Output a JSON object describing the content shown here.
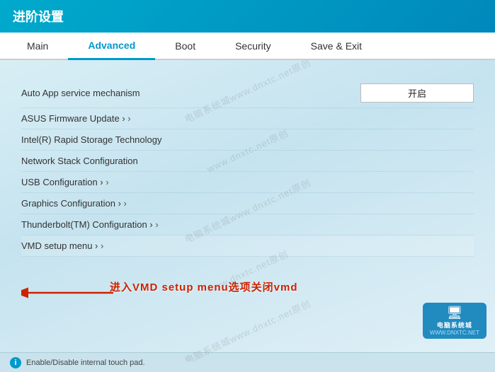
{
  "titleBar": {
    "text": "进阶设置"
  },
  "tabs": [
    {
      "id": "main",
      "label": "Main",
      "active": false
    },
    {
      "id": "advanced",
      "label": "Advanced",
      "active": true
    },
    {
      "id": "boot",
      "label": "Boot",
      "active": false
    },
    {
      "id": "security",
      "label": "Security",
      "active": false
    },
    {
      "id": "save-exit",
      "label": "Save & Exit",
      "active": false
    }
  ],
  "settings": [
    {
      "id": "auto-app",
      "label": "Auto App service mechanism",
      "value": "开启",
      "hasValue": true,
      "hasArrow": false
    },
    {
      "id": "asus-firmware",
      "label": "ASUS Firmware Update",
      "value": "",
      "hasValue": false,
      "hasArrow": true
    },
    {
      "id": "intel-rst",
      "label": "Intel(R) Rapid Storage Technology",
      "value": "",
      "hasValue": false,
      "hasArrow": false
    },
    {
      "id": "network-stack",
      "label": "Network Stack Configuration",
      "value": "",
      "hasValue": false,
      "hasArrow": false
    },
    {
      "id": "usb-config",
      "label": "USB Configuration",
      "value": "",
      "hasValue": false,
      "hasArrow": true
    },
    {
      "id": "graphics-config",
      "label": "Graphics Configuration",
      "value": "",
      "hasValue": false,
      "hasArrow": true
    },
    {
      "id": "thunderbolt",
      "label": "Thunderbolt(TM) Configuration",
      "value": "",
      "hasValue": false,
      "hasArrow": true
    },
    {
      "id": "vmd-setup",
      "label": "VMD setup menu",
      "value": "",
      "hasValue": false,
      "hasArrow": true
    }
  ],
  "annotation": {
    "text": "进入VMD setup menu选项关闭vmd"
  },
  "bottomBar": {
    "text": "Enable/Disable internal touch pad."
  },
  "watermarks": [
    "www.dnxtc.net原创",
    "电脑系统城www.dnxtc.net原创",
    "www.dnxtc.net原创",
    "电脑系统城www.dnxtc.net原创",
    "www.dnxtc.net原创",
    "电脑系统城www.dnxtc.net原创"
  ],
  "brand": {
    "name": "电脑系统城",
    "url": "WWW.DNXTC.NET"
  }
}
